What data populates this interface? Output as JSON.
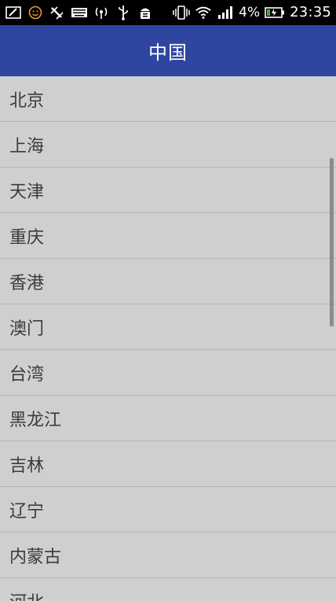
{
  "status_bar": {
    "battery_percent": "4%",
    "time": "23:35"
  },
  "app_bar": {
    "title": "中国"
  },
  "list": {
    "items": [
      {
        "label": "北京"
      },
      {
        "label": "上海"
      },
      {
        "label": "天津"
      },
      {
        "label": "重庆"
      },
      {
        "label": "香港"
      },
      {
        "label": "澳门"
      },
      {
        "label": "台湾"
      },
      {
        "label": "黑龙江"
      },
      {
        "label": "吉林"
      },
      {
        "label": "辽宁"
      },
      {
        "label": "内蒙古"
      },
      {
        "label": "河北"
      }
    ]
  },
  "colors": {
    "app_bar": "#2f46a0",
    "list_background": "#cfcfcf",
    "divider": "#b6b6b6",
    "status_bar": "#000000"
  }
}
